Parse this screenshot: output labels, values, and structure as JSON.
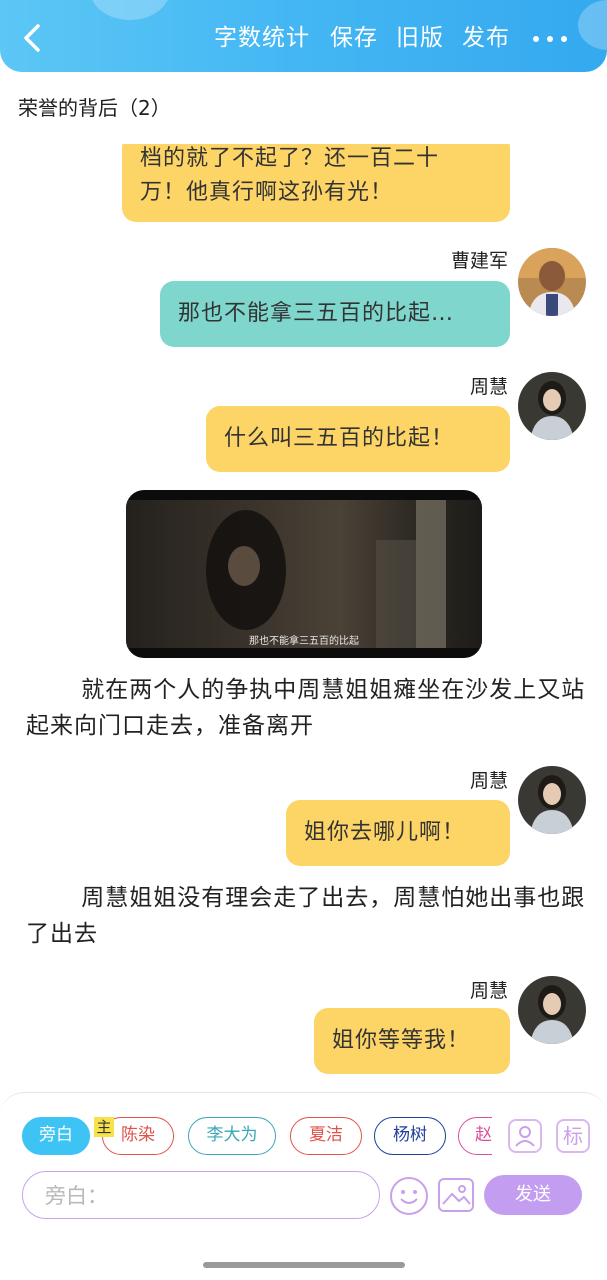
{
  "header": {
    "word_count_label": "字数统计",
    "save_label": "保存",
    "old_version_label": "旧版",
    "publish_label": "发布"
  },
  "doc_title": "荣誉的背后（2）",
  "messages": [
    {
      "type": "bubble",
      "color": "#fdd466",
      "text_line1": "档的就了不起了？还一百二十",
      "text_line2": "万！他真行啊这孙有光！"
    },
    {
      "type": "bubble",
      "speaker": "曹建军",
      "color": "#7fd6cc",
      "text": "那也不能拿三五百的比起…"
    },
    {
      "type": "bubble",
      "speaker": "周慧",
      "color": "#fdd466",
      "text": "什么叫三五百的比起！"
    },
    {
      "type": "video",
      "subtitle": "那也不能拿三五百的比起"
    },
    {
      "type": "narration",
      "text": "就在两个人的争执中周慧姐姐瘫坐在沙发上又站起来向门口走去，准备离开"
    },
    {
      "type": "bubble",
      "speaker": "周慧",
      "color": "#fdd466",
      "text": "姐你去哪儿啊！"
    },
    {
      "type": "narration",
      "text": "周慧姐姐没有理会走了出去，周慧怕她出事也跟了出去"
    },
    {
      "type": "bubble",
      "speaker": "周慧",
      "color": "#fdd466",
      "text": "姐你等等我！"
    }
  ],
  "composer": {
    "host_tag": "主",
    "roles": [
      {
        "label": "旁白",
        "color": "#3ec3f5"
      },
      {
        "label": "陈染",
        "color": "#e0524a"
      },
      {
        "label": "李大为",
        "color": "#3aa6b4"
      },
      {
        "label": "夏洁",
        "color": "#e0524a"
      },
      {
        "label": "杨树",
        "color": "#1f3f9a"
      },
      {
        "label": "赵",
        "color": "#d9509a"
      }
    ],
    "role_icon_label": "标",
    "input_placeholder": "旁白：",
    "send_label": "发送"
  }
}
